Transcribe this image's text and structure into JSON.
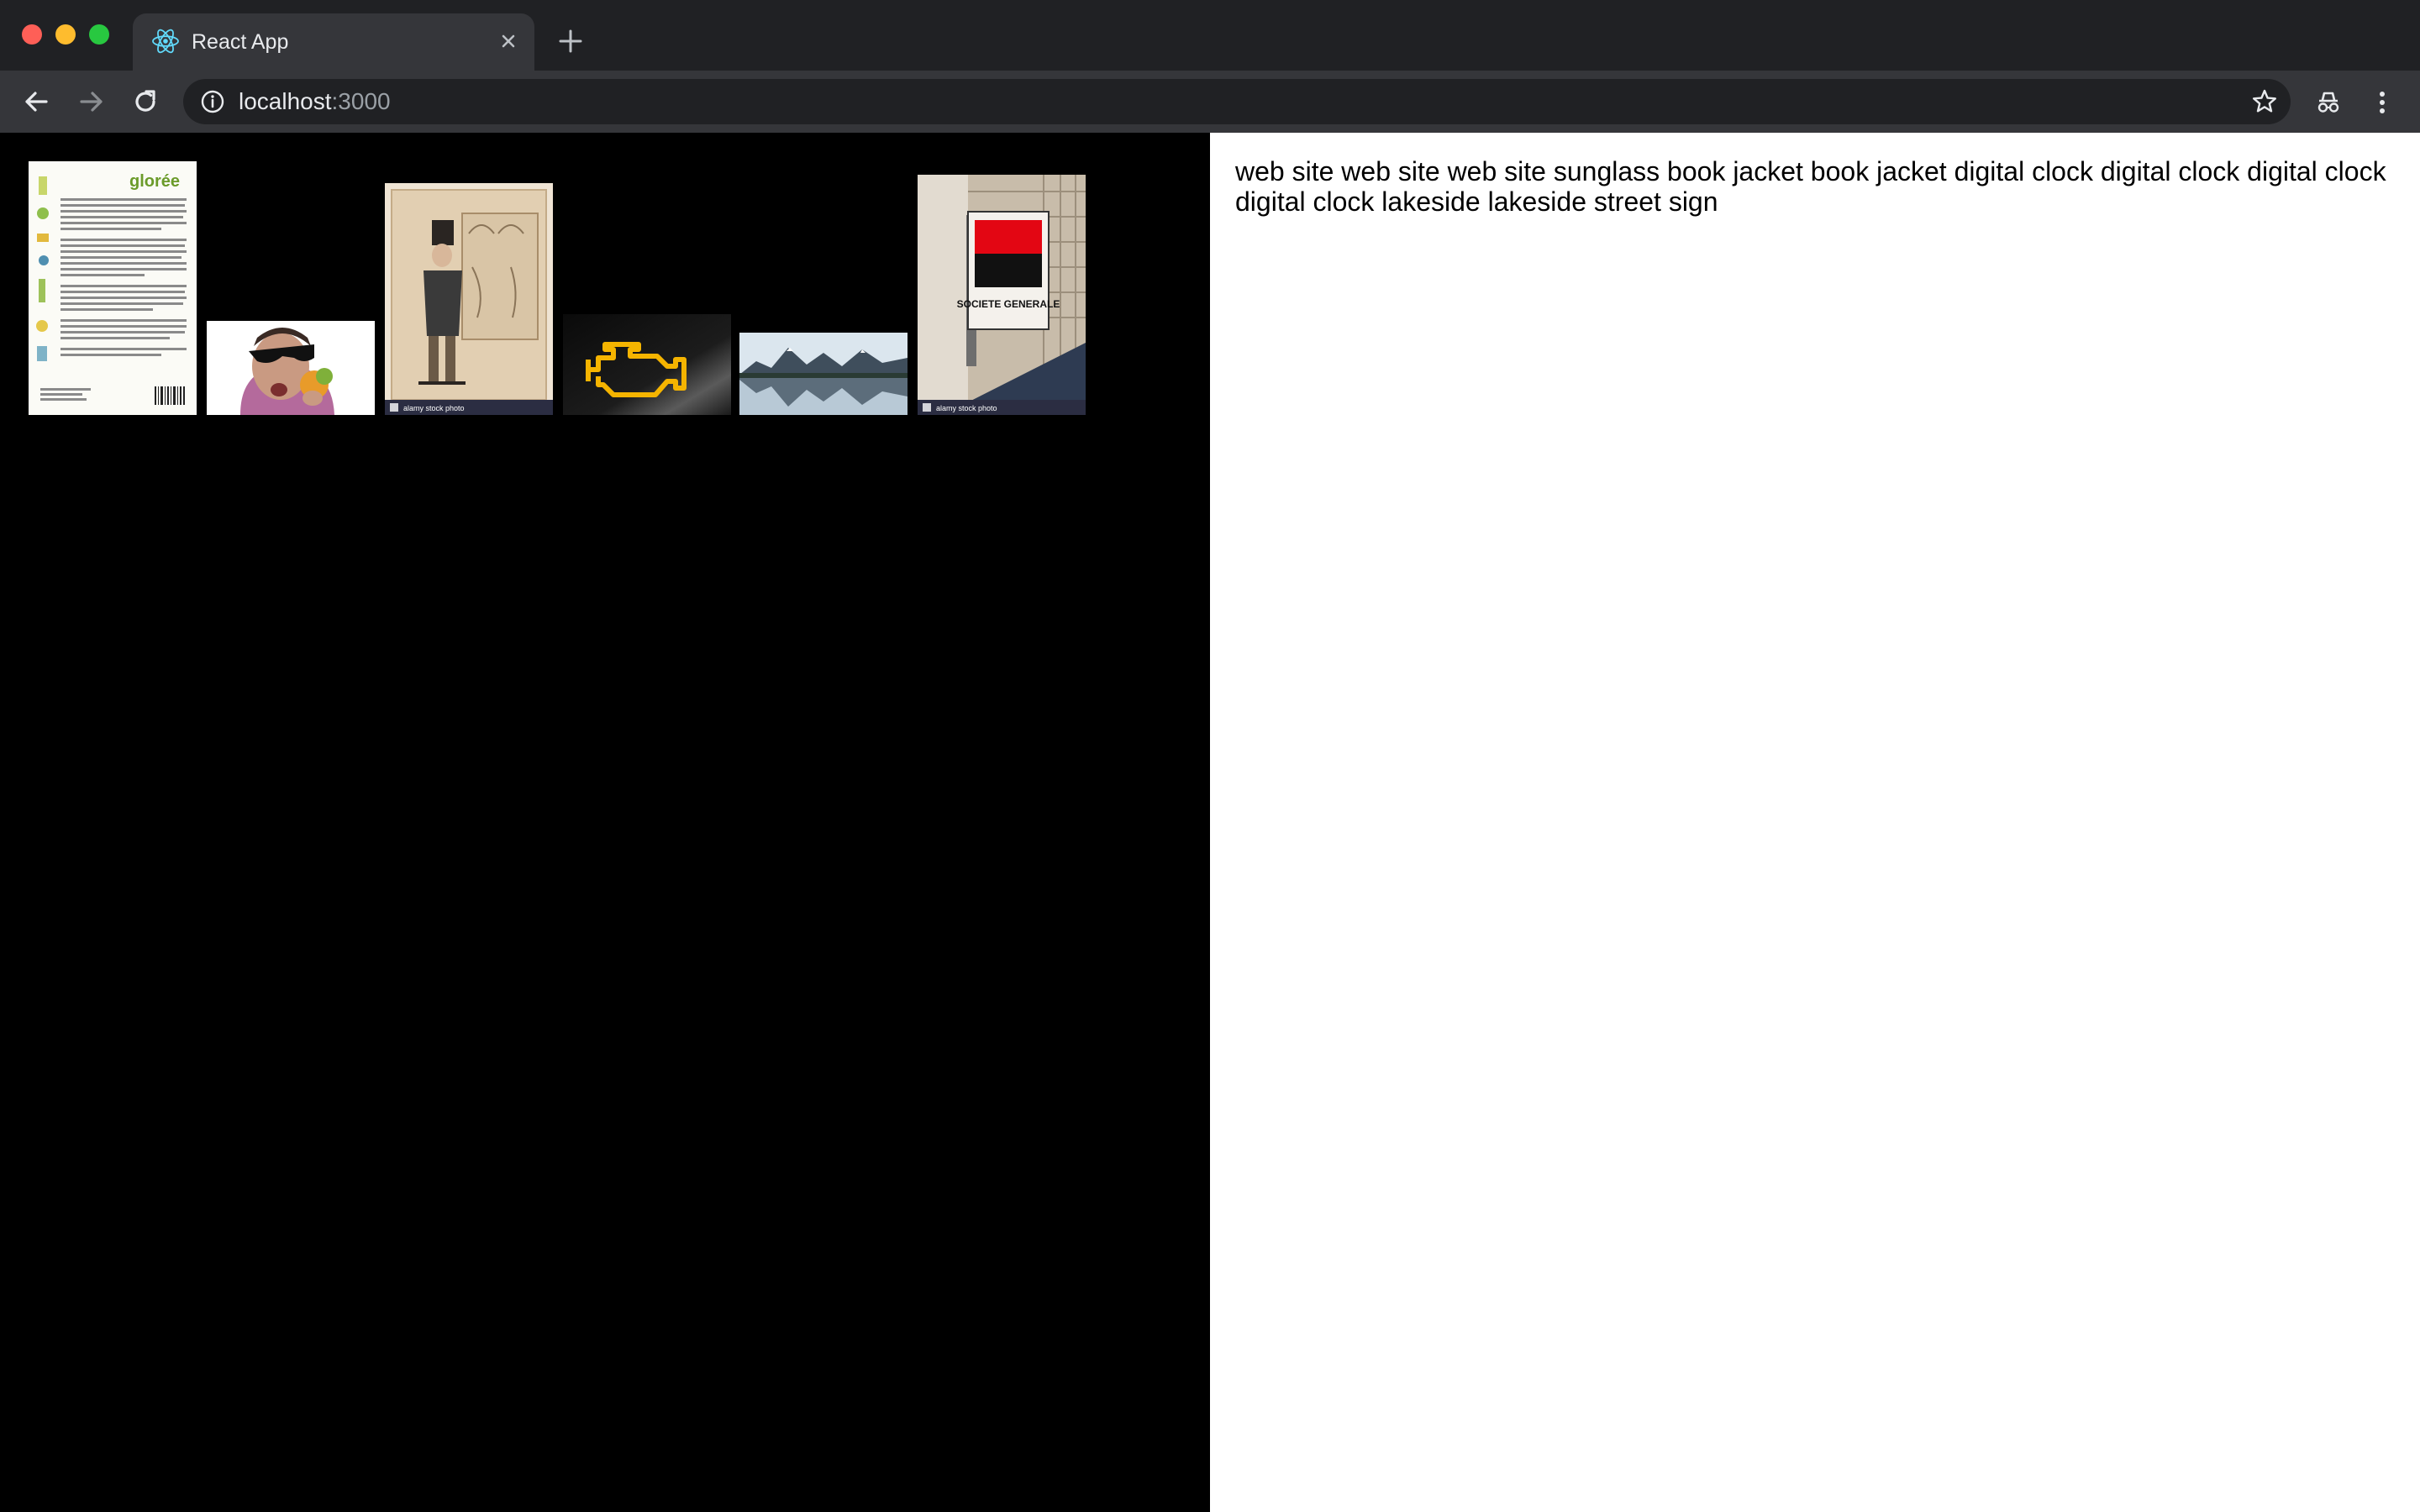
{
  "browser": {
    "tab_title": "React App",
    "url_host": "localhost",
    "url_port": ":3000"
  },
  "gallery": {
    "images": [
      {
        "label": "book jacket",
        "logo_text": "glorée"
      },
      {
        "label": "sunglass"
      },
      {
        "label": "book jacket",
        "watermark": "alamy stock photo"
      },
      {
        "label": "digital clock"
      },
      {
        "label": "lakeside"
      },
      {
        "label": "street sign",
        "sign_text": "SOCIETE GENERALE",
        "watermark": "alamy stock photo"
      }
    ]
  },
  "predictions": {
    "text": "web site web site web site sunglass book jacket book jacket digital clock digital clock digital clock digital clock lakeside lakeside street sign"
  },
  "colors": {
    "left_bg": "#000000",
    "right_bg": "#ffffff",
    "chrome_dark": "#202124",
    "chrome_toolbar": "#35363a"
  }
}
